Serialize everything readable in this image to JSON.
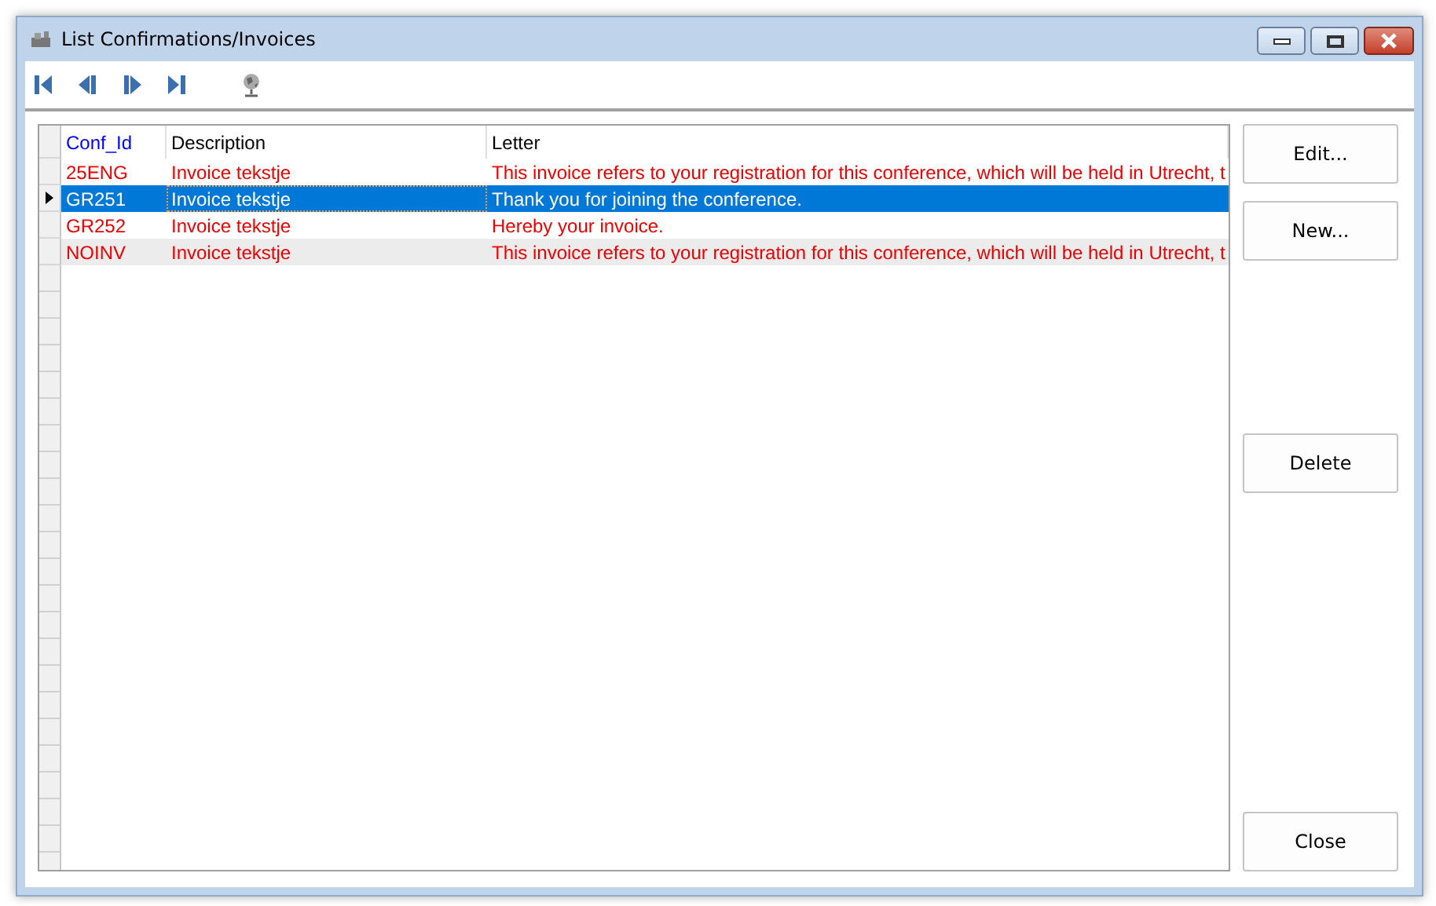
{
  "window": {
    "title": "List Confirmations/Invoices"
  },
  "table": {
    "columns": [
      "Conf_Id",
      "Description",
      "Letter"
    ],
    "rows": [
      {
        "cells": [
          "25ENG",
          "Invoice tekstje",
          "This invoice refers to your registration for this conference, which will be held in Utrecht, t"
        ],
        "selected": false
      },
      {
        "cells": [
          "GR251",
          "Invoice tekstje",
          "Thank you for joining the conference."
        ],
        "selected": true
      },
      {
        "cells": [
          "GR252",
          "Invoice tekstje",
          "Hereby your invoice."
        ],
        "selected": false
      },
      {
        "cells": [
          "NOINV",
          "Invoice tekstje",
          "This invoice refers to your registration for this conference, which will be held in Utrecht, t"
        ],
        "selected": false
      }
    ]
  },
  "buttons": [
    {
      "label": "Edit...",
      "kind": "edit"
    },
    {
      "label": "New...",
      "kind": "new"
    },
    {
      "label": "Delete",
      "kind": "delete"
    },
    {
      "label": "Close",
      "kind": "close"
    }
  ]
}
